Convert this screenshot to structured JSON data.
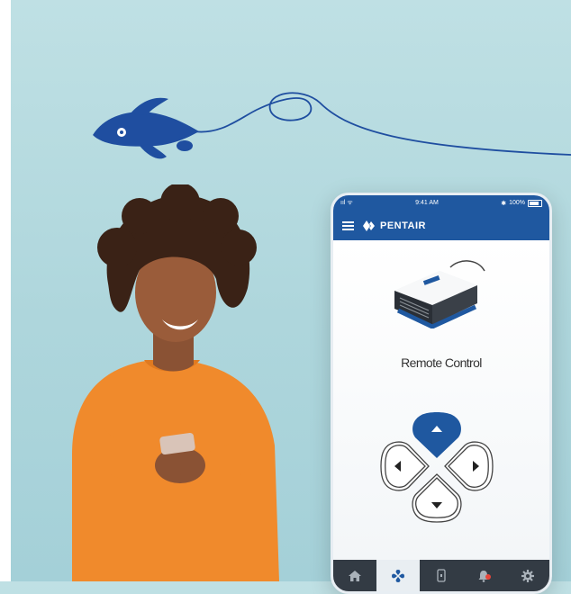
{
  "status_bar": {
    "signal": "ııl ᯤ",
    "time": "9:41 AM",
    "bluetooth": "✱",
    "battery_text": "100%"
  },
  "header": {
    "menu_icon": "hamburger-icon",
    "brand_name": "PENTAIR"
  },
  "screen": {
    "title": "Remote Control"
  },
  "dpad": {
    "buttons": [
      "up",
      "left",
      "right",
      "down"
    ],
    "active": "up"
  },
  "tab_bar": {
    "tabs": [
      "home-icon",
      "remote-control-icon",
      "phone-icon",
      "alerts-icon",
      "settings-icon"
    ],
    "active_index": 1
  },
  "colors": {
    "brand_blue": "#1f58a0",
    "tab_dark": "#333b44",
    "background": "#aed6dc"
  }
}
